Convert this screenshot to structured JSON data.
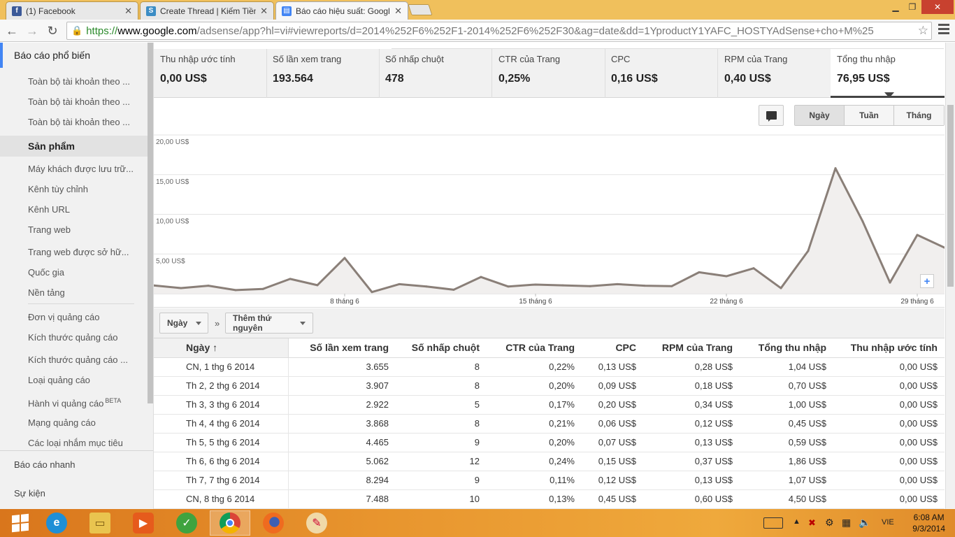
{
  "browser": {
    "tabs": [
      {
        "title": "(1) Facebook",
        "icon": "facebook-icon",
        "color": "#3b5998"
      },
      {
        "title": "Create Thread | Kiếm Tiền",
        "icon": "site-icon",
        "color": "#3c8dc5"
      },
      {
        "title": "Báo cáo hiệu suất: Google",
        "icon": "adsense-icon",
        "color": "#4285f4"
      }
    ],
    "url_scheme": "https://",
    "url_host": "www.google.com",
    "url_path": "/adsense/app?hl=vi#viewreports/d=2014%252F6%252F1-2014%252F6%252F30&ag=date&dd=1YproductY1YAFC_HOSTYAdSense+cho+M%25"
  },
  "sidebar": {
    "top_section": "Báo cáo phổ biến",
    "top_items": [
      "Toàn bộ tài khoản theo ...",
      "Toàn bộ tài khoản theo ...",
      "Toàn bộ tài khoản theo ..."
    ],
    "products_label": "Sản phẩm",
    "group1": [
      "Máy khách được lưu trữ...",
      "Kênh tùy chỉnh",
      "Kênh URL",
      "Trang web",
      "Trang web được sở hữ...",
      "Quốc gia",
      "Nền tảng"
    ],
    "group2": [
      "Đơn vị quảng cáo",
      "Kích thước quảng cáo",
      "Kích thước quảng cáo ...",
      "Loại quảng cáo",
      "Hành vi quảng cáo",
      "Mạng quảng cáo",
      "Các loại nhắm mục tiêu"
    ],
    "beta_badge": "BETA",
    "quick_reports": "Báo cáo nhanh",
    "events": "Sự kiện"
  },
  "metrics": [
    {
      "label": "Thu nhập ước tính",
      "value": "0,00 US$"
    },
    {
      "label": "Số lần xem trang",
      "value": "193.564"
    },
    {
      "label": "Số nhấp chuột",
      "value": "478"
    },
    {
      "label": "CTR của Trang",
      "value": "0,25%"
    },
    {
      "label": "CPC",
      "value": "0,16 US$"
    },
    {
      "label": "RPM của Trang",
      "value": "0,40 US$"
    },
    {
      "label": "Tổng thu nhập",
      "value": "76,95 US$"
    }
  ],
  "granularity": [
    "Ngày",
    "Tuần",
    "Tháng"
  ],
  "chart_data": {
    "type": "area",
    "series": [
      {
        "values": [
          1.04,
          0.7,
          1.0,
          0.45,
          0.59,
          1.86,
          1.07,
          4.5,
          0.2,
          1.2,
          0.9,
          0.5,
          2.1,
          0.9,
          1.15,
          1.05,
          0.95,
          1.2,
          1.0,
          0.95,
          2.7,
          2.2,
          3.2,
          0.7,
          5.4,
          15.8,
          9.1,
          1.4,
          7.4,
          5.8
        ]
      }
    ],
    "ylabels": [
      "5,00 US$",
      "10,00 US$",
      "15,00 US$",
      "20,00 US$"
    ],
    "yticks": [
      5,
      10,
      15,
      20
    ],
    "ylim": [
      0,
      20
    ],
    "xlabels": [
      {
        "day": 8,
        "label": "8 tháng 6"
      },
      {
        "day": 15,
        "label": "15 tháng 6"
      },
      {
        "day": 22,
        "label": "22 tháng 6"
      },
      {
        "day": 29,
        "label": "29 tháng 6"
      }
    ],
    "xlim": [
      1,
      30
    ],
    "grid": true,
    "line_color": "#8a7f78",
    "fill_color": "#f1efee"
  },
  "dimension": {
    "primary": "Ngày",
    "add": "Thêm thứ nguyên",
    "arrow": "»"
  },
  "table": {
    "headers": [
      "Ngày ↑",
      "Số lần xem trang",
      "Số nhấp chuột",
      "CTR của Trang",
      "CPC",
      "RPM của Trang",
      "Tổng thu nhập",
      "Thu nhập ước tính"
    ],
    "rows": [
      [
        "CN, 1 thg 6 2014",
        "3.655",
        "8",
        "0,22%",
        "0,13 US$",
        "0,28 US$",
        "1,04 US$",
        "0,00 US$"
      ],
      [
        "Th 2, 2 thg 6 2014",
        "3.907",
        "8",
        "0,20%",
        "0,09 US$",
        "0,18 US$",
        "0,70 US$",
        "0,00 US$"
      ],
      [
        "Th 3, 3 thg 6 2014",
        "2.922",
        "5",
        "0,17%",
        "0,20 US$",
        "0,34 US$",
        "1,00 US$",
        "0,00 US$"
      ],
      [
        "Th 4, 4 thg 6 2014",
        "3.868",
        "8",
        "0,21%",
        "0,06 US$",
        "0,12 US$",
        "0,45 US$",
        "0,00 US$"
      ],
      [
        "Th 5, 5 thg 6 2014",
        "4.465",
        "9",
        "0,20%",
        "0,07 US$",
        "0,13 US$",
        "0,59 US$",
        "0,00 US$"
      ],
      [
        "Th 6, 6 thg 6 2014",
        "5.062",
        "12",
        "0,24%",
        "0,15 US$",
        "0,37 US$",
        "1,86 US$",
        "0,00 US$"
      ],
      [
        "Th 7, 7 thg 6 2014",
        "8.294",
        "9",
        "0,11%",
        "0,12 US$",
        "0,13 US$",
        "1,07 US$",
        "0,00 US$"
      ],
      [
        "CN, 8 thg 6 2014",
        "7.488",
        "10",
        "0,13%",
        "0,45 US$",
        "0,60 US$",
        "4,50 US$",
        "0,00 US$"
      ]
    ]
  },
  "taskbar": {
    "apps": [
      "windows-explorer-icon",
      "internet-explorer-icon",
      "file-explorer-icon",
      "media-player-icon",
      "app-icon",
      "chrome-icon",
      "firefox-icon",
      "paint-icon"
    ],
    "lang": "VIE",
    "time": "6:08 AM",
    "date": "9/3/2014"
  }
}
